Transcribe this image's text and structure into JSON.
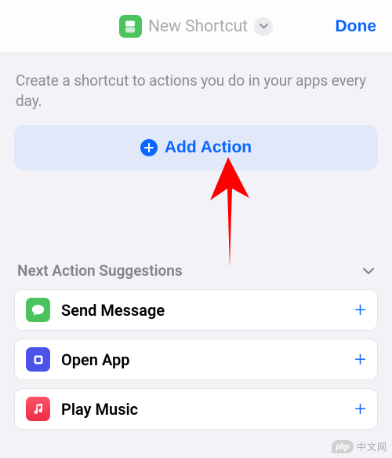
{
  "header": {
    "title": "New Shortcut",
    "done_label": "Done"
  },
  "intro_text": "Create a shortcut to actions you do in your apps every day.",
  "add_action": {
    "label": "Add Action"
  },
  "suggestions": {
    "title": "Next Action Suggestions",
    "items": [
      {
        "label": "Send Message",
        "icon": "messages-icon",
        "color": "#4bc45e"
      },
      {
        "label": "Open App",
        "icon": "shortcuts-icon",
        "color": "#4b53e8"
      },
      {
        "label": "Play Music",
        "icon": "music-icon",
        "color": "#ef2c46"
      }
    ]
  },
  "watermark": {
    "badge": "php",
    "text": "中文网"
  }
}
